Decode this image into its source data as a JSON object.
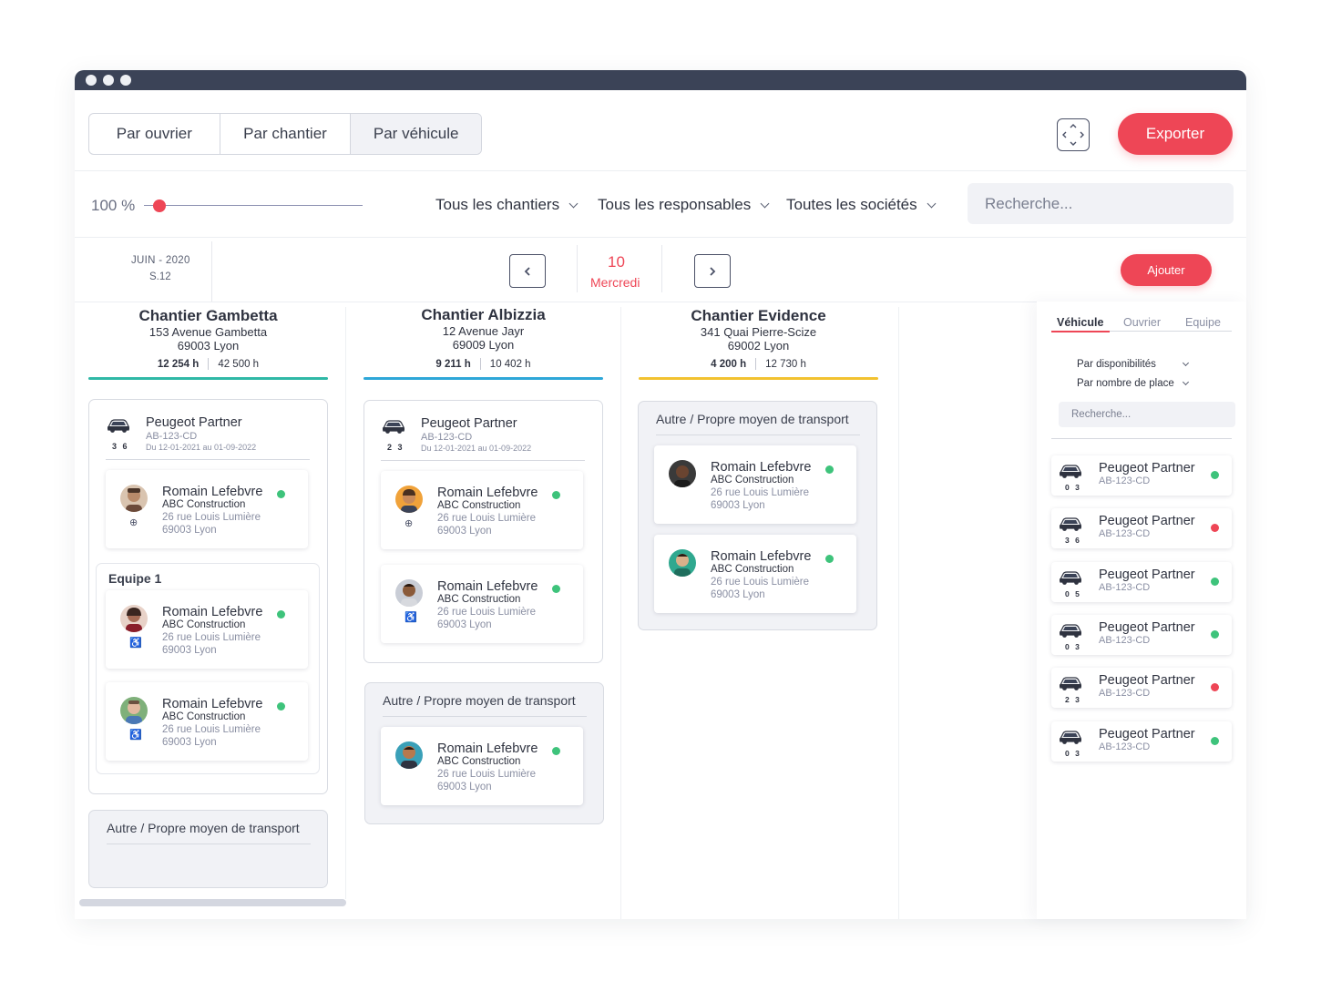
{
  "view_tabs": [
    "Par ouvrier",
    "Par chantier",
    "Par véhicule"
  ],
  "export_label": "Exporter",
  "zoom": {
    "label": "100 %",
    "level": 0.05
  },
  "filters": [
    "Tous les chantiers",
    "Tous les responsables",
    "Toutes les sociétés"
  ],
  "search": {
    "placeholder": "Recherche..."
  },
  "date": {
    "month": "JUIN - 2020",
    "week": "S.12",
    "day_number": "10",
    "day_name": "Mercredi"
  },
  "add_label": "Ajouter",
  "colors": {
    "accent": "#ee4656",
    "teal": "#2fb8a6",
    "blue": "#2ea7d8",
    "yellow": "#f2c230",
    "green": "#3ec37b",
    "dark": "#3b4357"
  },
  "chantiers": [
    {
      "title": "Chantier Gambetta",
      "address": "153 Avenue Gambetta",
      "city": "69003 Lyon",
      "hours_done": "12 254 h",
      "hours_total": "42 500 h"
    },
    {
      "title": "Chantier Albizzia",
      "address": "12 Avenue Jayr",
      "city": "69009 Lyon",
      "hours_done": "9 211 h",
      "hours_total": "10 402 h"
    },
    {
      "title": "Chantier Evidence",
      "address": "341 Quai Pierre-Scize",
      "city": "69002 Lyon",
      "hours_done": "4 200 h",
      "hours_total": "12 730 h"
    }
  ],
  "vehicle": {
    "name": "Peugeot Partner",
    "plate": "AB-123-CD",
    "dates": "Du 12-01-2021 au 01-09-2022"
  },
  "vehicle_numbers": [
    "3 6",
    "2 3"
  ],
  "worker": {
    "name": "Romain Lefebvre",
    "company": "ABC Construction",
    "address": "26 rue Louis Lumière",
    "city": "69003 Lyon"
  },
  "team_label": "Equipe 1",
  "other_transport_label": "Autre / Propre moyen de transport",
  "side_panel": {
    "tabs": [
      "Véhicule",
      "Ouvrier",
      "Equipe"
    ],
    "filters": [
      "Par disponibilités",
      "Par nombre de place"
    ],
    "search_placeholder": "Recherche...",
    "items": [
      {
        "name": "Peugeot Partner",
        "plate": "AB-123-CD",
        "seats": "0 3",
        "status": "available"
      },
      {
        "name": "Peugeot Partner",
        "plate": "AB-123-CD",
        "seats": "3 6",
        "status": "unavailable"
      },
      {
        "name": "Peugeot Partner",
        "plate": "AB-123-CD",
        "seats": "0 5",
        "status": "available"
      },
      {
        "name": "Peugeot Partner",
        "plate": "AB-123-CD",
        "seats": "0 3",
        "status": "available"
      },
      {
        "name": "Peugeot Partner",
        "plate": "AB-123-CD",
        "seats": "2 3",
        "status": "unavailable"
      },
      {
        "name": "Peugeot Partner",
        "plate": "AB-123-CD",
        "seats": "0 3",
        "status": "available"
      }
    ]
  }
}
